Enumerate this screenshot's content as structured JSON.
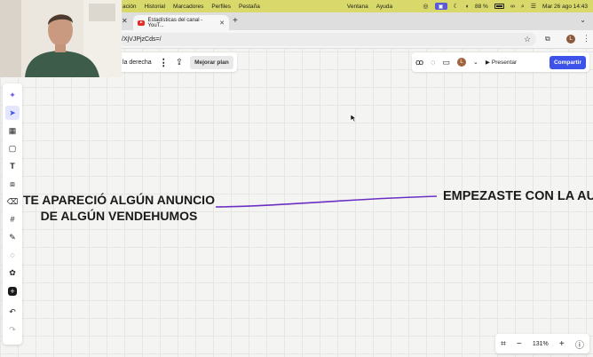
{
  "menubar": {
    "items_left": [
      "ación",
      "Historial",
      "Marcadores",
      "Perfiles",
      "Pestaña"
    ],
    "items_right": [
      "Ventana",
      "Ayuda"
    ],
    "battery": "88 %",
    "datetime": "Mar 26 ago 14:43"
  },
  "browser": {
    "tab_title": "Estadísticas del canal - YouT...",
    "url": "/XjVJPjzCds=/",
    "profile_letter": "L"
  },
  "board": {
    "name_fragment": "la derecha",
    "upgrade_label": "Mejorar plan",
    "present_label": "Presentar",
    "share_label": "Compartir",
    "avatar_letter": "L"
  },
  "canvas": {
    "left_line1": "TE APARECIÓ ALGÚN ANUNCIO",
    "left_line2": "DE ALGÚN VENDEHUMOS",
    "right_text": "EMPEZASTE CON LA AUT",
    "connector_color": "#6b2fc4"
  },
  "zoom": {
    "level": "131%"
  },
  "colors": {
    "accent": "#3d52e8",
    "menubar": "#d9d96b",
    "youtube": "#e52d27"
  }
}
